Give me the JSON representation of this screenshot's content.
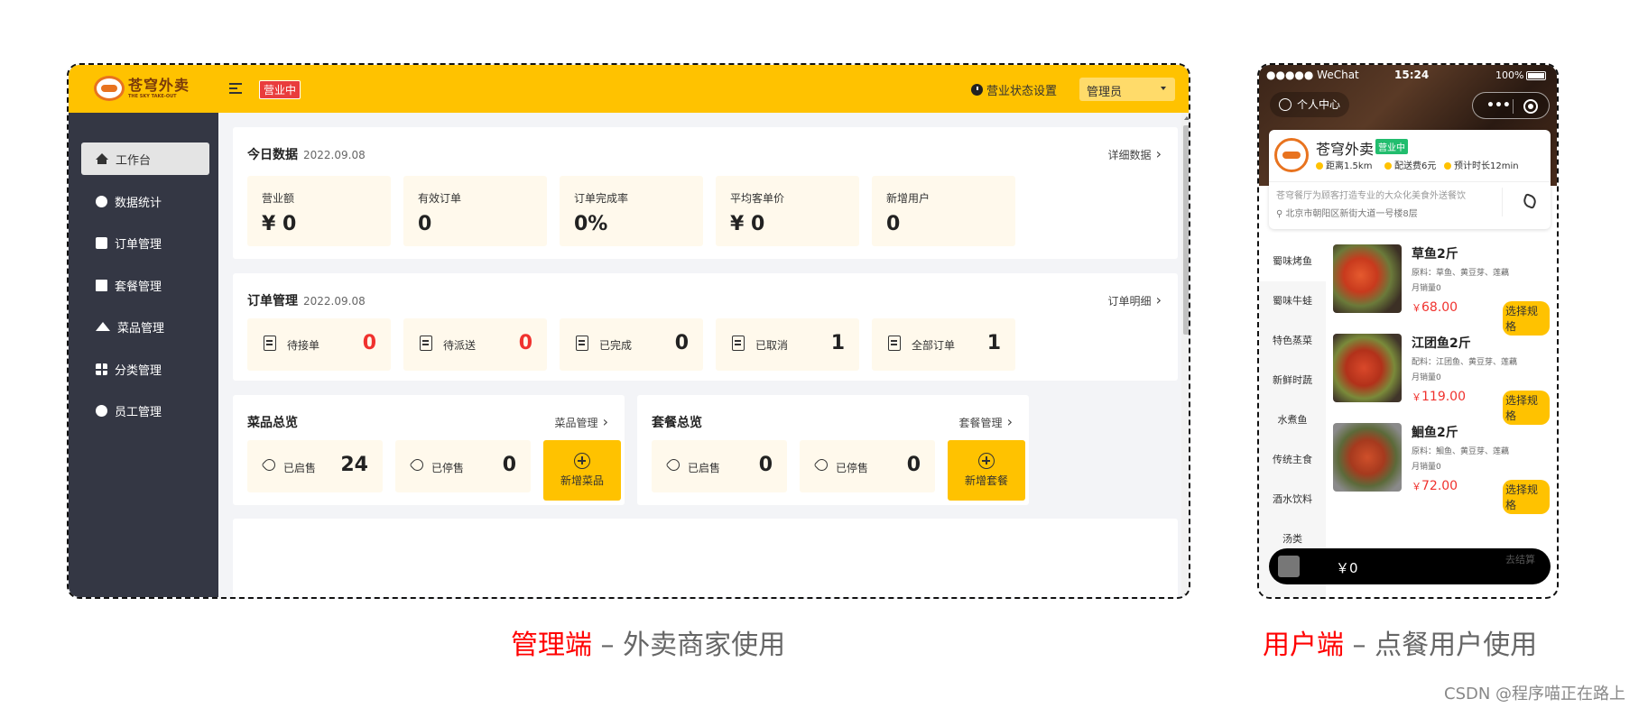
{
  "admin": {
    "logo": {
      "cn": "苍穹外卖",
      "en": "THE SKY TAKE-OUT"
    },
    "status_badge": "营业中",
    "status_setting": "营业状态设置",
    "user_dropdown": "管理员",
    "sidebar": [
      {
        "label": "工作台",
        "icon": "home-icon",
        "active": true
      },
      {
        "label": "数据统计",
        "icon": "chart-icon"
      },
      {
        "label": "订单管理",
        "icon": "clipboard-icon"
      },
      {
        "label": "套餐管理",
        "icon": "gift-icon"
      },
      {
        "label": "菜品管理",
        "icon": "dish-cover-icon"
      },
      {
        "label": "分类管理",
        "icon": "grid-icon"
      },
      {
        "label": "员工管理",
        "icon": "info-icon"
      }
    ],
    "today": {
      "title": "今日数据",
      "date": "2022.09.08",
      "link": "详细数据",
      "stats": [
        {
          "label": "营业额",
          "value": "¥ 0"
        },
        {
          "label": "有效订单",
          "value": "0"
        },
        {
          "label": "订单完成率",
          "value": "0%"
        },
        {
          "label": "平均客单价",
          "value": "¥ 0"
        },
        {
          "label": "新增用户",
          "value": "0"
        }
      ]
    },
    "orders": {
      "title": "订单管理",
      "date": "2022.09.08",
      "link": "订单明细",
      "items": [
        {
          "label": "待接单",
          "value": "0",
          "highlight": true
        },
        {
          "label": "待派送",
          "value": "0",
          "highlight": true
        },
        {
          "label": "已完成",
          "value": "0"
        },
        {
          "label": "已取消",
          "value": "1"
        },
        {
          "label": "全部订单",
          "value": "1"
        }
      ]
    },
    "dishes": {
      "title": "菜品总览",
      "link": "菜品管理",
      "on_label": "已启售",
      "on_value": "24",
      "off_label": "已停售",
      "off_value": "0",
      "add_label": "新增菜品"
    },
    "setmeals": {
      "title": "套餐总览",
      "link": "套餐管理",
      "on_label": "已启售",
      "on_value": "0",
      "off_label": "已停售",
      "off_value": "0",
      "add_label": "新增套餐"
    }
  },
  "phone": {
    "status_bar": {
      "carrier": "●●●●● WeChat",
      "time": "15:24",
      "battery": "100%"
    },
    "personal": "个人中心",
    "shop": {
      "name": "苍穹外卖",
      "badge": "营业中",
      "distance": "距离1.5km",
      "delivery_fee": "配送费6元",
      "eta": "预计时长12min",
      "desc": "苍穹餐厅为顾客打造专业的大众化美食外送餐饮",
      "address": "北京市朝阳区新街大道一号楼8层"
    },
    "categories": [
      "蜀味烤鱼",
      "蜀味牛蛙",
      "特色蒸菜",
      "新鲜时蔬",
      "水煮鱼",
      "传统主食",
      "酒水饮料",
      "汤类"
    ],
    "dishes": [
      {
        "name": "草鱼2斤",
        "ingredients": "原料：草鱼、黄豆芽、莲藕",
        "monthly": "月销量0",
        "price": "￥68.00",
        "button": "选择规格"
      },
      {
        "name": "江团鱼2斤",
        "ingredients": "配料：江团鱼、黄豆芽、莲藕",
        "monthly": "月销量0",
        "price": "￥119.00",
        "button": "选择规格"
      },
      {
        "name": "鮰鱼2斤",
        "ingredients": "原料：鮰鱼、黄豆芽、莲藕",
        "monthly": "月销量0",
        "price": "￥72.00",
        "button": "选择规格"
      }
    ],
    "cart": {
      "amount": "￥0",
      "checkout": "去结算"
    }
  },
  "captions": {
    "admin_hl": "管理端",
    "admin_rest": " – 外卖商家使用",
    "user_hl": "用户端",
    "user_rest": " – 点餐用户使用"
  },
  "watermark": "CSDN @程序喵正在路上",
  "colors": {
    "brand": "#ffc200",
    "sidebar": "#343744",
    "accent_red": "#f0322e",
    "open_green": "#22bd6e"
  }
}
